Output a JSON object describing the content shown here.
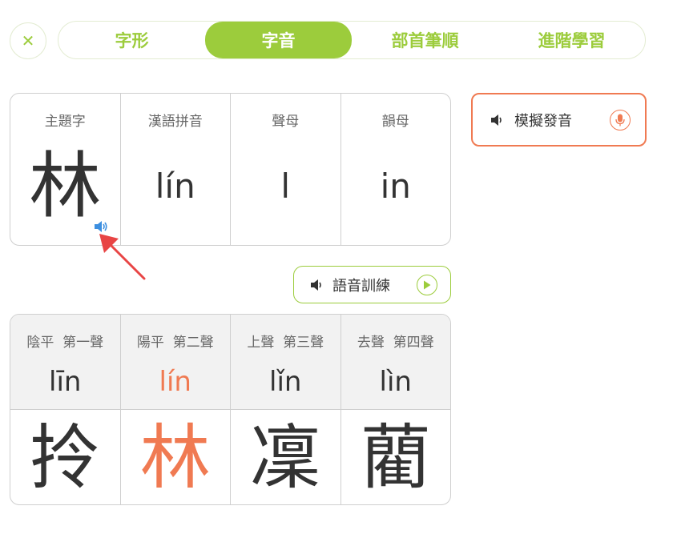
{
  "close_symbol": "✕",
  "tabs": [
    {
      "label": "字形",
      "active": false
    },
    {
      "label": "字音",
      "active": true
    },
    {
      "label": "部首筆順",
      "active": false
    },
    {
      "label": "進階學習",
      "active": false
    }
  ],
  "char_table": {
    "columns": [
      {
        "label": "主題字",
        "value": "林"
      },
      {
        "label": "漢語拼音",
        "value": "lín"
      },
      {
        "label": "聲母",
        "value": "l"
      },
      {
        "label": "韻母",
        "value": "in"
      }
    ]
  },
  "imitate_button": {
    "label": "模擬發音",
    "icon": "microphone-icon"
  },
  "train_button": {
    "label": "語音訓練",
    "icon": "play-icon"
  },
  "tone_table": {
    "columns": [
      {
        "tone": "陰平",
        "order": "第一聲",
        "pinyin": "līn",
        "char": "拎",
        "highlighted": false
      },
      {
        "tone": "陽平",
        "order": "第二聲",
        "pinyin": "lín",
        "char": "林",
        "highlighted": true
      },
      {
        "tone": "上聲",
        "order": "第三聲",
        "pinyin": "lǐn",
        "char": "凜",
        "highlighted": false
      },
      {
        "tone": "去聲",
        "order": "第四聲",
        "pinyin": "lìn",
        "char": "藺",
        "highlighted": false
      }
    ]
  },
  "colors": {
    "accent_green": "#9ccc3c",
    "accent_orange": "#f07a52",
    "speaker_blue": "#3d8fe0"
  }
}
